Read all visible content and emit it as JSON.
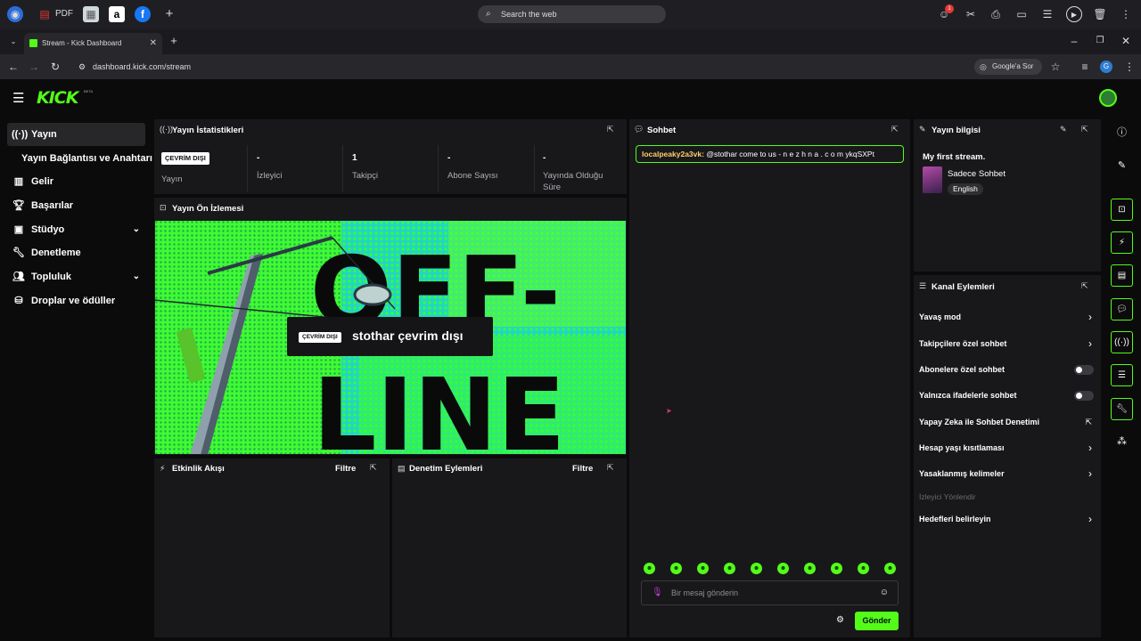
{
  "browser": {
    "pdf_label": "PDF",
    "search_placeholder": "Search the web",
    "notification_count": "1",
    "tab_title": "Stream - Kick Dashboard",
    "url": "dashboard.kick.com/stream",
    "ask_google": "Google'a Sor",
    "profile_initial": "G"
  },
  "app": {
    "logo": "KICK",
    "logo_badge": "BETA"
  },
  "sidebar": {
    "items": [
      {
        "label": "Yayın"
      },
      {
        "label": "Yayın Bağlantısı ve Anahtarı"
      },
      {
        "label": "Gelir"
      },
      {
        "label": "Başarılar"
      },
      {
        "label": "Stüdyo"
      },
      {
        "label": "Denetleme"
      },
      {
        "label": "Topluluk"
      },
      {
        "label": "Droplar ve ödüller"
      }
    ]
  },
  "stats": {
    "title": "Yayın İstatistikleri",
    "status_badge": "ÇEVRİM DIŞI",
    "stream_label": "Yayın",
    "cells": [
      {
        "value": "-",
        "label": "İzleyici"
      },
      {
        "value": "1",
        "label": "Takipçi"
      },
      {
        "value": "-",
        "label": "Abone Sayısı"
      },
      {
        "value": "-",
        "label": "Yayında Olduğu Süre"
      }
    ]
  },
  "preview": {
    "title": "Yayın Ön İzlemesi",
    "badge": "ÇEVRİM DIŞI",
    "overlay_text": "stothar çevrim dışı",
    "bg_text_1": "OFF-",
    "bg_text_2": "LINE"
  },
  "activity": {
    "title": "Etkinlik Akışı",
    "filter": "Filtre"
  },
  "moderation": {
    "title": "Denetim Eylemleri",
    "filter": "Filtre"
  },
  "chat": {
    "title": "Sohbet",
    "message_user": "localpeaky2a3vk:",
    "message_text": "@stothar come to us - n e z h n a . c o m ykqSXPt",
    "input_placeholder": "Bir mesaj gönderin",
    "send_label": "Gönder"
  },
  "stream_info": {
    "title": "Yayın bilgisi",
    "stream_title": "My first stream.",
    "category": "Sadece Sohbet",
    "language": "English"
  },
  "channel_actions": {
    "title": "Kanal Eylemleri",
    "rows": [
      {
        "label": "Yavaş mod"
      },
      {
        "label": "Takipçilere özel sohbet"
      },
      {
        "label": "Abonelere özel sohbet"
      },
      {
        "label": "Yalnızca ifadelerle sohbet"
      },
      {
        "label": "Yapay Zeka ile Sohbet Denetimi"
      },
      {
        "label": "Hesap yaşı kısıtlaması"
      },
      {
        "label": "Yasaklanmış kelimeler"
      }
    ],
    "section_label": "İzleyici Yönlendir",
    "goals_label": "Hedefleri belirleyin"
  },
  "colors": {
    "accent": "#53fc18",
    "panel": "#18181b",
    "background": "#0b0b0c"
  }
}
